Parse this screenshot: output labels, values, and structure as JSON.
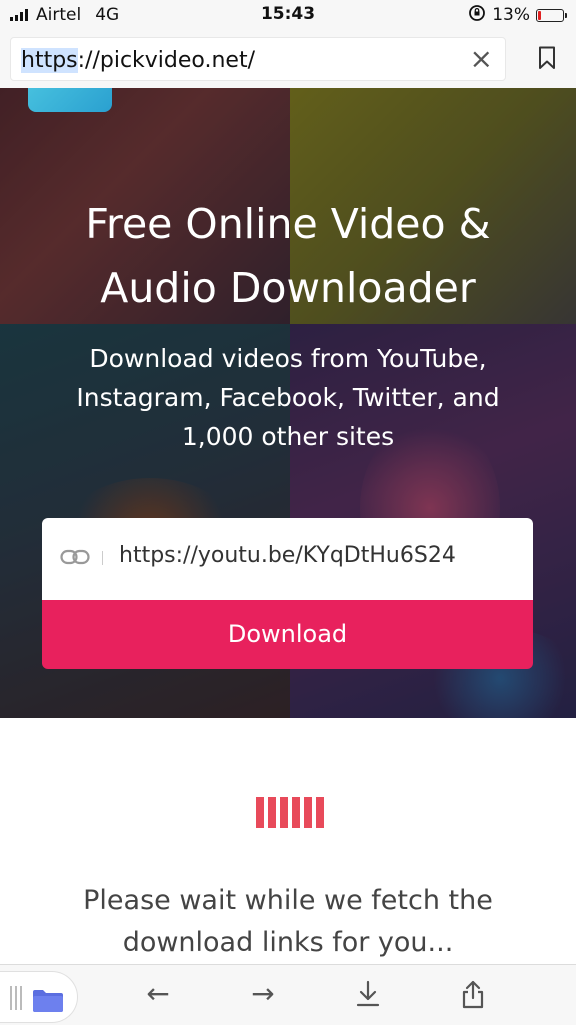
{
  "status_bar": {
    "carrier": "Airtel",
    "network": "4G",
    "time": "15:43",
    "battery_percent": "13%",
    "battery_level": 0.13
  },
  "browser": {
    "url_selected_part": "https",
    "url_rest": "://pickvideo.net/",
    "close_glyph": "×"
  },
  "hero": {
    "title_line1": "Free Online Video &",
    "title_line2": "Audio Downloader",
    "subtitle": "Download videos from YouTube, Instagram, Facebook, Twitter, and 1,000 other sites",
    "input_value": "https://youtu.be/KYqDtHu6S24",
    "download_label": "Download"
  },
  "loading": {
    "message": "Please wait while we fetch the download links for you..."
  },
  "toolbar": {
    "back_glyph": "←",
    "forward_glyph": "→"
  },
  "colors": {
    "accent": "#e8215d",
    "loader": "#e84a5a",
    "folder": "#5b6ee0"
  }
}
